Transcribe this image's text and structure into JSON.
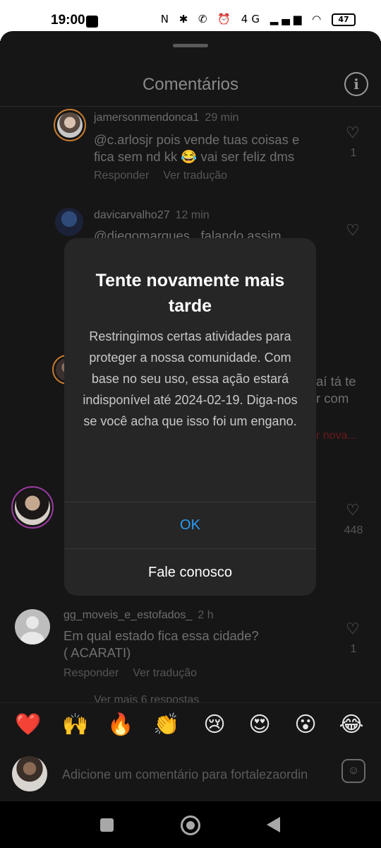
{
  "status_bar": {
    "time": "19:00",
    "icons_text": "N ✱ ✆ ⏰ 4G ▂▄▆ ◠",
    "battery": "47"
  },
  "sheet": {
    "title": "Comentários"
  },
  "comments": [
    {
      "username": "jamersonmendonca1",
      "time": "29 min",
      "text_line1": "@c.arlosjr pois vende tuas coisas e",
      "text_line2": "fica sem nd kk 😂 vai ser feliz dms",
      "reply": "Responder",
      "translate": "Ver tradução",
      "likes": "1"
    },
    {
      "username": "davicarvalho27",
      "time": "12 min",
      "text_line1": "@diegomarques_ falando assim"
    },
    {
      "fragment1": "aí tá te",
      "fragment2": "r com",
      "fragment3": "r nova..."
    },
    {
      "likes": "448"
    },
    {
      "username": "gg_moveis_e_estofados_",
      "time": "2 h",
      "text_line1": "Em qual estado fica essa cidade?",
      "text_line2": "( ACARATI)",
      "reply": "Responder",
      "translate": "Ver tradução",
      "likes": "1",
      "more_replies": "Ver mais 6 respostas"
    }
  ],
  "emoji_bar": [
    "❤️",
    "🙌",
    "🔥",
    "👏",
    "😢",
    "😍",
    "😮",
    "😂"
  ],
  "comment_input": {
    "placeholder": "Adicione um comentário para fortalezaordin"
  },
  "dialog": {
    "title": "Tente novamente mais tarde",
    "body": "Restringimos certas atividades para proteger a nossa comunidade. Com base no seu uso, essa ação estará indisponível até 2024-02-19. Diga-nos se você acha que isso foi um engano.",
    "ok_label": "OK",
    "contact_label": "Fale conosco"
  },
  "colors": {
    "accent": "#2b9cf2",
    "dialog_bg": "#262626",
    "sheet_bg": "#161616",
    "overflow_red": "#6b1a1a"
  }
}
